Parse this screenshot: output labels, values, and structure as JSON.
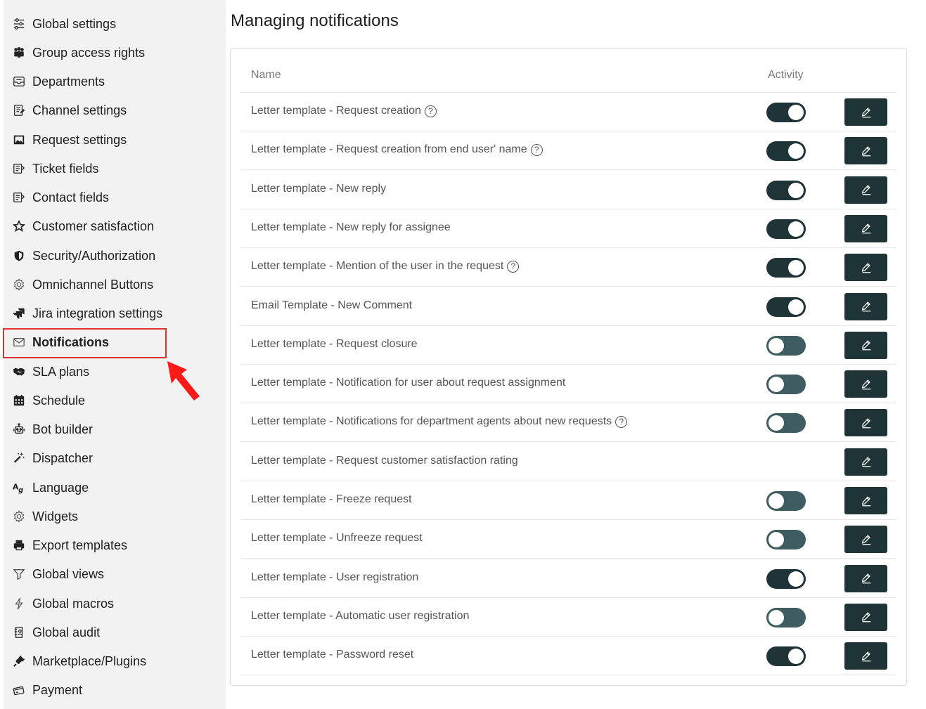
{
  "sidebar": {
    "items": [
      {
        "label": "Global settings",
        "icon": "sliders-icon"
      },
      {
        "label": "Group access rights",
        "icon": "group-icon"
      },
      {
        "label": "Departments",
        "icon": "inbox-icon"
      },
      {
        "label": "Channel settings",
        "icon": "channel-icon"
      },
      {
        "label": "Request settings",
        "icon": "image-icon"
      },
      {
        "label": "Ticket fields",
        "icon": "fields-icon"
      },
      {
        "label": "Contact fields",
        "icon": "fields-icon"
      },
      {
        "label": "Customer satisfaction",
        "icon": "star-icon"
      },
      {
        "label": "Security/Authorization",
        "icon": "shield-icon"
      },
      {
        "label": "Omnichannel Buttons",
        "icon": "gear-icon"
      },
      {
        "label": "Jira integration settings",
        "icon": "jira-icon"
      },
      {
        "label": "Notifications",
        "icon": "envelope-icon",
        "active": true
      },
      {
        "label": "SLA plans",
        "icon": "handshake-icon"
      },
      {
        "label": "Schedule",
        "icon": "calendar-icon"
      },
      {
        "label": "Bot builder",
        "icon": "robot-icon"
      },
      {
        "label": "Dispatcher",
        "icon": "magic-wand-icon"
      },
      {
        "label": "Language",
        "icon": "language-icon"
      },
      {
        "label": "Widgets",
        "icon": "gear-icon"
      },
      {
        "label": "Export templates",
        "icon": "printer-icon"
      },
      {
        "label": "Global views",
        "icon": "filter-icon"
      },
      {
        "label": "Global macros",
        "icon": "bolt-icon"
      },
      {
        "label": "Global audit",
        "icon": "audit-icon"
      },
      {
        "label": "Marketplace/Plugins",
        "icon": "plug-icon"
      },
      {
        "label": "Payment",
        "icon": "payment-icon"
      }
    ]
  },
  "main": {
    "title": "Managing notifications",
    "columns": {
      "name": "Name",
      "activity": "Activity"
    },
    "rows": [
      {
        "name": "Letter template - Request creation",
        "help": true,
        "active": true,
        "toggle": true
      },
      {
        "name": "Letter template - Request creation from end user' name",
        "help": true,
        "active": true,
        "toggle": true
      },
      {
        "name": "Letter template - New reply",
        "help": false,
        "active": true,
        "toggle": true
      },
      {
        "name": "Letter template - New reply for assignee",
        "help": false,
        "active": true,
        "toggle": true
      },
      {
        "name": "Letter template - Mention of the user in the request",
        "help": true,
        "active": true,
        "toggle": true
      },
      {
        "name": "Email Template - New Comment",
        "help": false,
        "active": true,
        "toggle": true
      },
      {
        "name": "Letter template - Request closure",
        "help": false,
        "active": false,
        "toggle": true
      },
      {
        "name": "Letter template - Notification for user about request assignment",
        "help": false,
        "active": false,
        "toggle": true
      },
      {
        "name": "Letter template - Notifications for department agents about new requests",
        "help": true,
        "active": false,
        "toggle": true
      },
      {
        "name": "Letter template - Request customer satisfaction rating",
        "help": false,
        "active": false,
        "toggle": false
      },
      {
        "name": "Letter template - Freeze request",
        "help": false,
        "active": false,
        "toggle": true
      },
      {
        "name": "Letter template - Unfreeze request",
        "help": false,
        "active": false,
        "toggle": true
      },
      {
        "name": "Letter template - User registration",
        "help": false,
        "active": true,
        "toggle": true
      },
      {
        "name": "Letter template - Automatic user registration",
        "help": false,
        "active": false,
        "toggle": true
      },
      {
        "name": "Letter template - Password reset",
        "help": false,
        "active": true,
        "toggle": true
      }
    ],
    "help_glyph": "?"
  },
  "colors": {
    "accent_dark": "#1f3436",
    "toggle_off": "#3f5c60",
    "highlight": "#e03131",
    "sidebar_bg": "#f2f2f2"
  }
}
